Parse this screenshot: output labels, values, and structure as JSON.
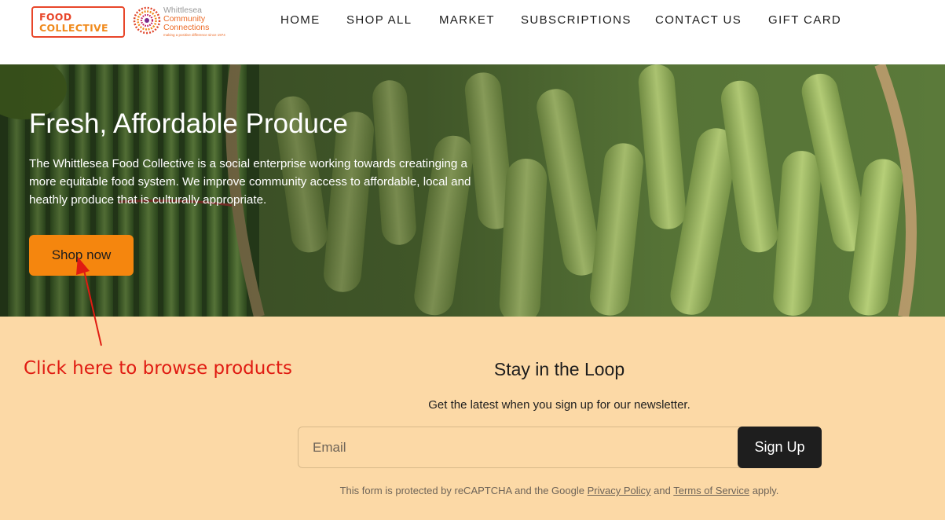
{
  "header": {
    "logo_food_line1": "FOOD",
    "logo_food_line2": "COLLECTIVE",
    "logo_partner_line1": "Whittlesea",
    "logo_partner_line2": "Community",
    "logo_partner_line3": "Connections",
    "logo_partner_tagline": "making a positive difference since 1974",
    "nav": [
      {
        "label": "HOME"
      },
      {
        "label": "SHOP ALL"
      },
      {
        "label": "MARKET"
      },
      {
        "label": "SUBSCRIPTIONS"
      },
      {
        "label": "CONTACT US"
      },
      {
        "label": "GIFT CARD"
      }
    ]
  },
  "hero": {
    "title": "Fresh, Affordable Produce",
    "description": "The Whittlesea Food Collective is a social enterprise working towards creatinging a more equitable food system. We improve community access to affordable, local and heathly produce that is culturally appropriate.",
    "button_label": "Shop now"
  },
  "annotation": {
    "text": "Click here to browse products"
  },
  "newsletter": {
    "title": "Stay in the Loop",
    "subtitle": "Get the latest when you sign up for our newsletter.",
    "email_placeholder": "Email",
    "signup_label": "Sign Up",
    "recaptcha_prefix": "This form is protected by reCAPTCHA and the Google",
    "privacy_link": "Privacy Policy",
    "recaptcha_and": "and",
    "terms_link": "Terms of Service",
    "recaptcha_suffix": "apply."
  },
  "colors": {
    "accent_orange": "#f5860e",
    "page_background": "#fcd9a6",
    "annotation_red": "#e01b12",
    "button_dark": "#1e1e1e"
  }
}
